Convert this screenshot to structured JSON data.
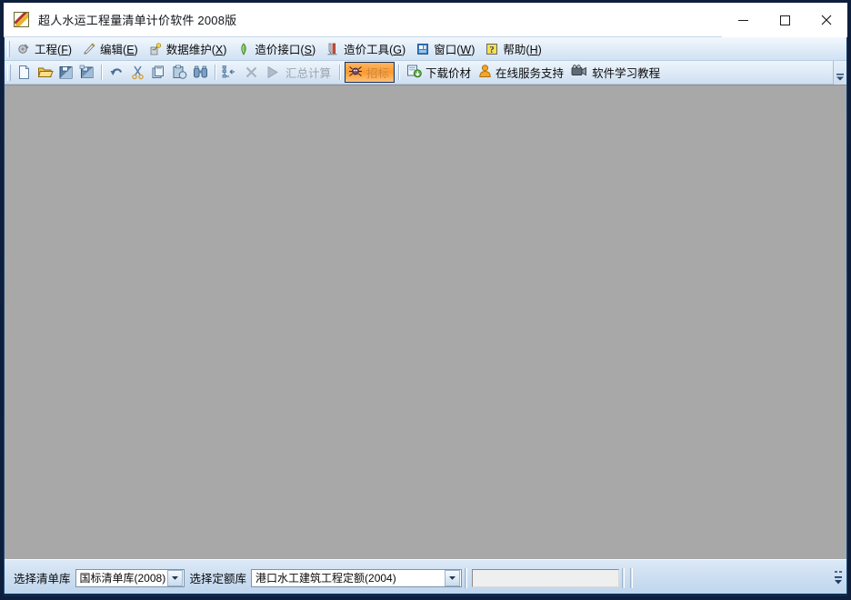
{
  "window": {
    "title": "超人水运工程量清单计价软件 2008版",
    "icon": "app-logo-icon",
    "controls": {
      "minimize": "minimize-icon",
      "maximize": "maximize-icon",
      "close": "close-icon"
    },
    "client_background": "#a8a8a8",
    "frame_color": "#0d1f3c"
  },
  "menubar": {
    "items": [
      {
        "label": "工程",
        "accel": "F",
        "icon": "project-gear-icon"
      },
      {
        "label": "编辑",
        "accel": "E",
        "icon": "edit-pencil-icon"
      },
      {
        "label": "数据维护",
        "accel": "X",
        "icon": "data-maintain-icon"
      },
      {
        "label": "造价接口",
        "accel": "S",
        "icon": "green-arrow-icon"
      },
      {
        "label": "造价工具",
        "accel": "G",
        "icon": "tools-icon"
      },
      {
        "label": "窗口",
        "accel": "W",
        "icon": "window-icon"
      },
      {
        "label": "帮助",
        "accel": "H",
        "icon": "help-question-icon"
      }
    ]
  },
  "toolbar": {
    "icon_buttons": [
      {
        "name": "new-file-button",
        "icon": "new-document-icon",
        "enabled": true
      },
      {
        "name": "open-file-button",
        "icon": "open-folder-icon",
        "enabled": true
      },
      {
        "name": "save-button",
        "icon": "save-disk-icon",
        "enabled": true
      },
      {
        "name": "save-as-button",
        "icon": "save-as-icon",
        "enabled": true
      },
      {
        "name": "undo-button",
        "icon": "undo-arrow-icon",
        "enabled": true
      },
      {
        "name": "cut-button",
        "icon": "scissors-icon",
        "enabled": true
      },
      {
        "name": "copy-button",
        "icon": "copy-icon",
        "enabled": true
      },
      {
        "name": "paste-button",
        "icon": "paste-icon",
        "enabled": true
      },
      {
        "name": "find-button",
        "icon": "binoculars-icon",
        "enabled": true
      },
      {
        "name": "indent-button",
        "icon": "indent-list-icon",
        "enabled": true
      },
      {
        "name": "delete-button",
        "icon": "delete-x-icon",
        "enabled": false
      },
      {
        "name": "run-button",
        "icon": "play-triangle-icon",
        "enabled": false
      }
    ],
    "summary_calc_label": "汇总计算",
    "summary_calc_enabled": false,
    "bid_button_label": "招标",
    "bid_button_icon": "bid-spider-icon",
    "bid_button_selected": true,
    "bid_button_color": "#fb9a30",
    "text_buttons": [
      {
        "label": "下载价材",
        "icon": "download-price-icon"
      },
      {
        "label": "在线服务支持",
        "icon": "online-support-icon"
      },
      {
        "label": "软件学习教程",
        "icon": "video-tutorial-icon"
      }
    ],
    "overflow_icon": "toolbar-overflow-icon"
  },
  "statusbar": {
    "clearing_library_label": "选择清单库",
    "clearing_library_value": "国标清单库(2008)",
    "quota_library_label": "选择定额库",
    "quota_library_value": "港口水工建筑工程定额(2004)",
    "status_field_value": "",
    "dropdown_icon": "chevron-down-icon",
    "resize_grip_icon": "resize-grip-icon"
  }
}
